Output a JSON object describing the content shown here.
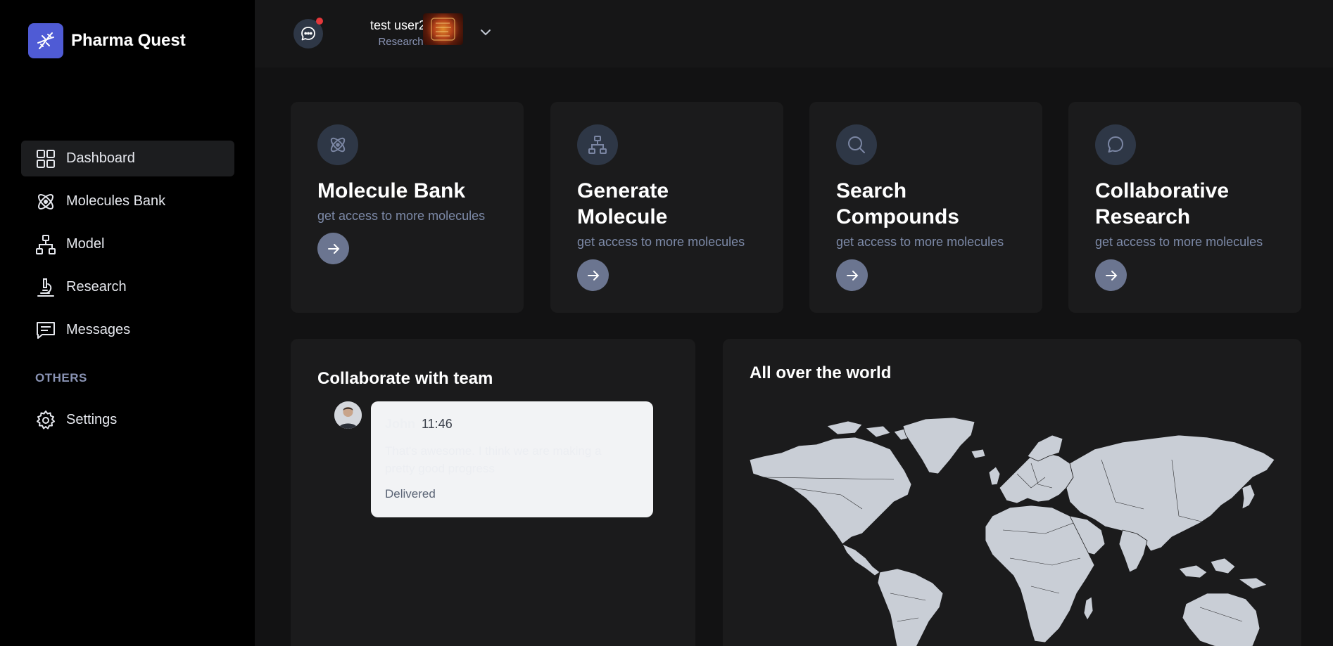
{
  "app": {
    "name": "Pharma Quest"
  },
  "sidebar": {
    "items": [
      {
        "label": "Dashboard",
        "icon": "grid-icon",
        "active": true
      },
      {
        "label": "Molecules Bank",
        "icon": "atom-icon"
      },
      {
        "label": "Model",
        "icon": "sitemap-icon"
      },
      {
        "label": "Research",
        "icon": "microscope-icon"
      },
      {
        "label": "Messages",
        "icon": "message-square-icon"
      }
    ],
    "others_label": "OTHERS",
    "settings_label": "Settings"
  },
  "header": {
    "user_name": "test user23",
    "user_role": "Researcher",
    "notification_dot": true
  },
  "cards": [
    {
      "title": "Molecule Bank",
      "subtitle": "get access to more molecules",
      "icon": "atom-icon"
    },
    {
      "title": "Generate Molecule",
      "subtitle": "get access to more molecules",
      "icon": "sitemap-icon"
    },
    {
      "title": "Search Compounds",
      "subtitle": "get access to more molecules",
      "icon": "search-icon"
    },
    {
      "title": "Collaborative Research",
      "subtitle": "get access to more molecules",
      "icon": "message-circle-icon"
    }
  ],
  "collaborate": {
    "title": "Collaborate with team",
    "message": {
      "author": "John",
      "time": "11:46",
      "text": "That's awesome. I think we are making a pretty good progress",
      "status": "Delivered"
    }
  },
  "world": {
    "title": "All over the world"
  },
  "colors": {
    "accent": "#4f5bd5",
    "sidebar_bg": "#000000",
    "main_bg": "#121213",
    "card_bg": "#1b1b1c",
    "icon_circle": "#2e3746",
    "arrow_circle": "#6b7590",
    "notification": "#e5383b",
    "map_land": "#c9ced6"
  }
}
